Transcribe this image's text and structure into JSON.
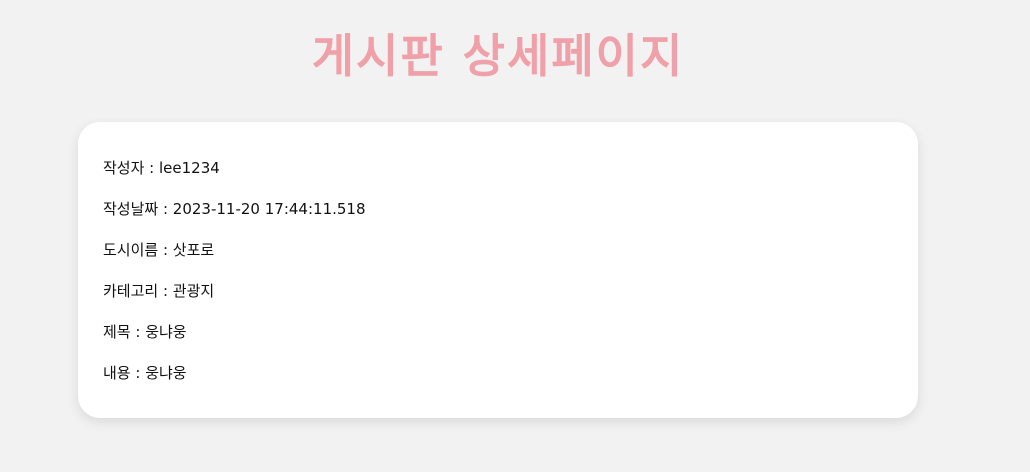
{
  "page": {
    "title": "게시판 상세페이지",
    "title_color": "#f0a0a8",
    "background_color": "#f2f2f2",
    "card_color": "#ffffff",
    "separator": " : "
  },
  "post": {
    "fields": [
      {
        "label": "작성자",
        "value": "lee1234"
      },
      {
        "label": "작성날짜",
        "value": "2023-11-20 17:44:11.518"
      },
      {
        "label": "도시이름",
        "value": "삿포로"
      },
      {
        "label": "카테고리",
        "value": "관광지"
      },
      {
        "label": "제목",
        "value": "웅냐웅"
      },
      {
        "label": "내용",
        "value": "웅냐웅"
      }
    ]
  }
}
